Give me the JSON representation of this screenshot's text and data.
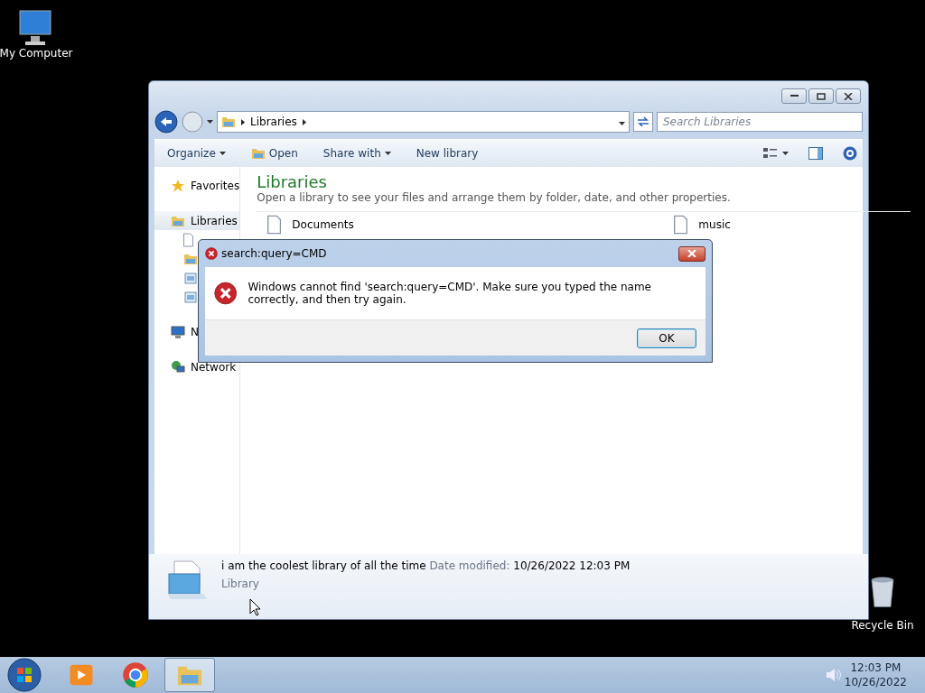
{
  "desktop_icons": [
    {
      "label": "My Computer",
      "kind": "computer"
    },
    {
      "label": "Recycle Bin",
      "kind": "bin"
    }
  ],
  "explorer": {
    "address": {
      "crumbs": [
        "Libraries"
      ]
    },
    "search": {
      "placeholder": "Search Libraries"
    },
    "toolbar": [
      {
        "label": "Organize",
        "dropdown": true,
        "kind": "plain"
      },
      {
        "label": "Open",
        "dropdown": false,
        "kind": "folder"
      },
      {
        "label": "Share with",
        "dropdown": true,
        "kind": "plain"
      },
      {
        "label": "New library",
        "dropdown": false,
        "kind": "plain"
      }
    ],
    "sidebar": [
      {
        "label": "Favorites",
        "kind": "star",
        "selected": false
      },
      {
        "label": "Libraries",
        "kind": "library",
        "selected": true,
        "children": [
          {
            "kind": "document"
          },
          {
            "kind": "folder"
          },
          {
            "kind": "picture"
          },
          {
            "kind": "picture"
          }
        ]
      },
      {
        "label": "N",
        "kind": "computer",
        "selected": false
      },
      {
        "label": "Network",
        "kind": "network",
        "selected": false
      }
    ],
    "content": {
      "title": "Libraries",
      "subtitle": "Open a library to see your files and arrange them by folder, date, and other properties.",
      "items": [
        {
          "label": "Documents"
        },
        {
          "label": "music"
        }
      ]
    },
    "details": {
      "name": "i am the coolest library of all the time",
      "date_label": "Date modified:",
      "date": "10/26/2022 12:03 PM",
      "type": "Library"
    }
  },
  "dialog": {
    "title": "search:query=CMD",
    "message": "Windows cannot find 'search:query=CMD'. Make sure you typed the name correctly, and then try again.",
    "buttons": [
      {
        "label": "OK",
        "selected": true
      }
    ]
  },
  "taskbar": {
    "apps": [
      {
        "kind": "media",
        "selected": false
      },
      {
        "kind": "chrome",
        "selected": false
      },
      {
        "kind": "explorer",
        "selected": true
      }
    ],
    "time": "12:03 PM",
    "date": "10/26/2022"
  }
}
